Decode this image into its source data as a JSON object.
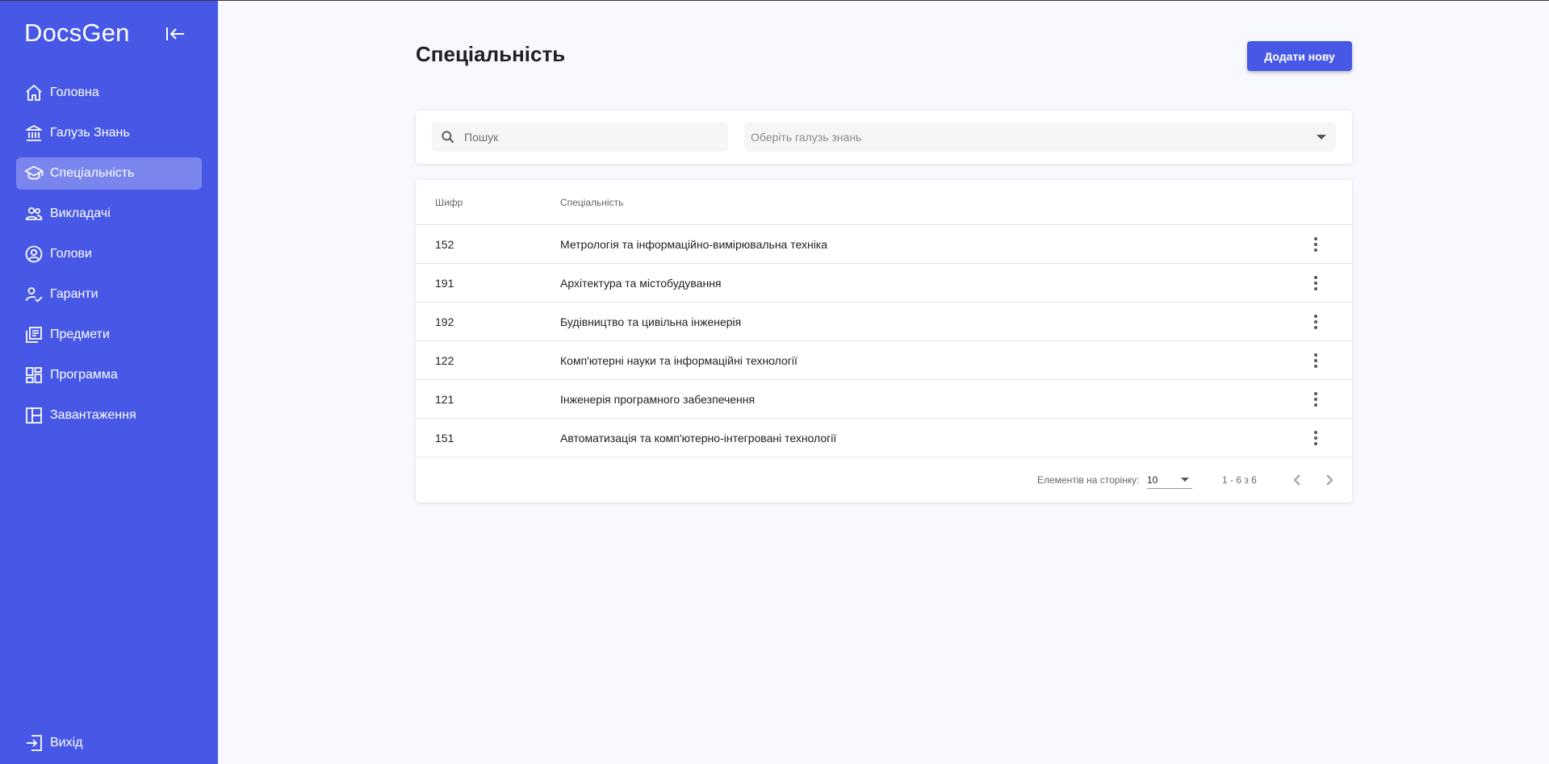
{
  "app": {
    "brand": "DocsGen"
  },
  "sidebar": {
    "items": [
      {
        "label": "Головна",
        "icon": "home-icon",
        "active": false
      },
      {
        "label": "Галузь Знань",
        "icon": "bank-icon",
        "active": false
      },
      {
        "label": "Спеціальність",
        "icon": "school-icon",
        "active": true
      },
      {
        "label": "Викладачі",
        "icon": "people-icon",
        "active": false
      },
      {
        "label": "Голови",
        "icon": "account-circle-icon",
        "active": false
      },
      {
        "label": "Гаранти",
        "icon": "person-check-icon",
        "active": false
      },
      {
        "label": "Предмети",
        "icon": "library-books-icon",
        "active": false
      },
      {
        "label": "Программа",
        "icon": "dashboard-icon",
        "active": false
      },
      {
        "label": "Завантаження",
        "icon": "layout-icon",
        "active": false
      }
    ],
    "logout_label": "Вихід"
  },
  "page": {
    "title": "Спеціальність",
    "add_button_label": "Додати нову"
  },
  "filters": {
    "search_placeholder": "Пошук",
    "select_placeholder": "Оберіть галузь знань"
  },
  "table": {
    "headers": {
      "code": "Шифр",
      "name": "Спеціальність"
    },
    "rows": [
      {
        "code": "152",
        "name": "Метрологія та інформаційно-вимірювальна техніка"
      },
      {
        "code": "191",
        "name": "Архітектура та містобудування"
      },
      {
        "code": "192",
        "name": "Будівництво та цивільна інженерія"
      },
      {
        "code": "122",
        "name": "Комп'ютерні науки та інформаційні технології"
      },
      {
        "code": "121",
        "name": "Інженерія програмного забезпечення"
      },
      {
        "code": "151",
        "name": "Автоматизація та комп'ютерно-інтегровані технології"
      }
    ]
  },
  "paginator": {
    "items_per_page_label": "Елементів на сторінку:",
    "page_size": "10",
    "range_label": "1 - 6 з 6"
  },
  "colors": {
    "sidebar_bg": "#4758e7",
    "accent": "#4758e7",
    "page_bg": "#f8f9fe"
  }
}
